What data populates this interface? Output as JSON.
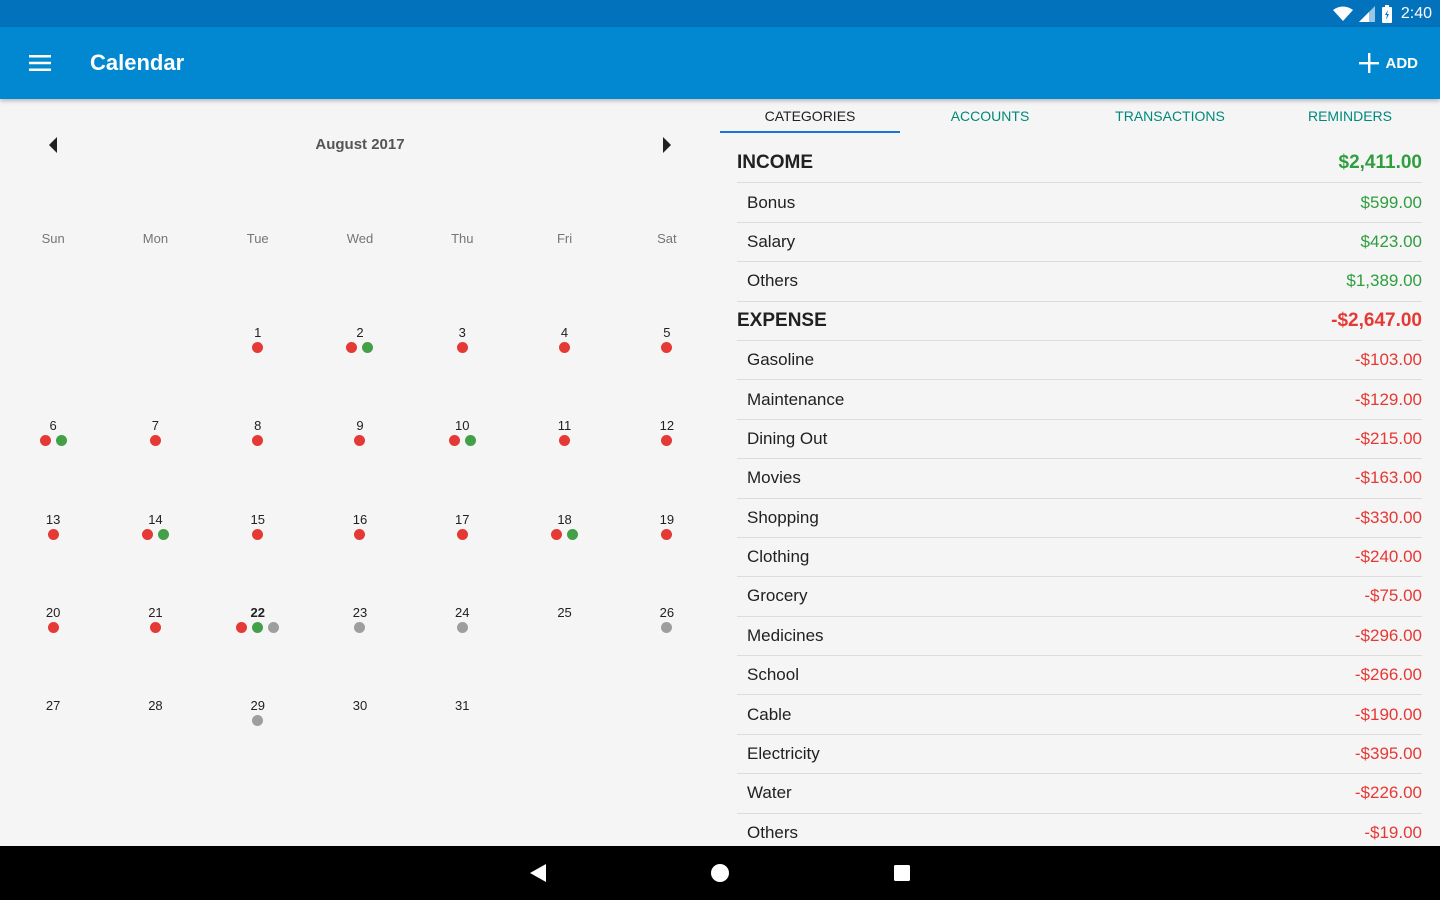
{
  "status_bar": {
    "time": "2:40"
  },
  "app_bar": {
    "title": "Calendar",
    "add_label": "ADD"
  },
  "calendar": {
    "month": "August 2017",
    "weekdays": [
      "Sun",
      "Mon",
      "Tue",
      "Wed",
      "Thu",
      "Fri",
      "Sat"
    ],
    "colors": {
      "income": "#43a047",
      "expense": "#e53935",
      "pending": "#9e9e9e"
    },
    "today": 22,
    "weeks": [
      [
        null,
        null,
        {
          "d": "1",
          "dots": [
            "expense"
          ]
        },
        {
          "d": "2",
          "dots": [
            "expense",
            "income"
          ]
        },
        {
          "d": "3",
          "dots": [
            "expense"
          ]
        },
        {
          "d": "4",
          "dots": [
            "expense"
          ]
        },
        {
          "d": "5",
          "dots": [
            "expense"
          ]
        }
      ],
      [
        {
          "d": "6",
          "dots": [
            "expense",
            "income"
          ]
        },
        {
          "d": "7",
          "dots": [
            "expense"
          ]
        },
        {
          "d": "8",
          "dots": [
            "expense"
          ]
        },
        {
          "d": "9",
          "dots": [
            "expense"
          ]
        },
        {
          "d": "10",
          "dots": [
            "expense",
            "income"
          ]
        },
        {
          "d": "11",
          "dots": [
            "expense"
          ]
        },
        {
          "d": "12",
          "dots": [
            "expense"
          ]
        }
      ],
      [
        {
          "d": "13",
          "dots": [
            "expense"
          ]
        },
        {
          "d": "14",
          "dots": [
            "expense",
            "income"
          ]
        },
        {
          "d": "15",
          "dots": [
            "expense"
          ]
        },
        {
          "d": "16",
          "dots": [
            "expense"
          ]
        },
        {
          "d": "17",
          "dots": [
            "expense"
          ]
        },
        {
          "d": "18",
          "dots": [
            "expense",
            "income"
          ]
        },
        {
          "d": "19",
          "dots": [
            "expense"
          ]
        }
      ],
      [
        {
          "d": "20",
          "dots": [
            "expense"
          ]
        },
        {
          "d": "21",
          "dots": [
            "expense"
          ]
        },
        {
          "d": "22",
          "dots": [
            "expense",
            "income",
            "pending"
          ]
        },
        {
          "d": "23",
          "dots": [
            "pending"
          ]
        },
        {
          "d": "24",
          "dots": [
            "pending"
          ]
        },
        {
          "d": "25",
          "dots": []
        },
        {
          "d": "26",
          "dots": [
            "pending"
          ]
        }
      ],
      [
        {
          "d": "27",
          "dots": []
        },
        {
          "d": "28",
          "dots": []
        },
        {
          "d": "29",
          "dots": [
            "pending"
          ]
        },
        {
          "d": "30",
          "dots": []
        },
        {
          "d": "31",
          "dots": []
        },
        null,
        null
      ]
    ]
  },
  "tabs": [
    {
      "label": "CATEGORIES",
      "active": true
    },
    {
      "label": "ACCOUNTS",
      "active": false
    },
    {
      "label": "TRANSACTIONS",
      "active": false
    },
    {
      "label": "REMINDERS",
      "active": false
    }
  ],
  "income": {
    "label": "INCOME",
    "total": "$2,411.00",
    "items": [
      {
        "name": "Bonus",
        "amount": "$599.00"
      },
      {
        "name": "Salary",
        "amount": "$423.00"
      },
      {
        "name": "Others",
        "amount": "$1,389.00"
      }
    ]
  },
  "expense": {
    "label": "EXPENSE",
    "total": "-$2,647.00",
    "items": [
      {
        "name": "Gasoline",
        "amount": "-$103.00"
      },
      {
        "name": "Maintenance",
        "amount": "-$129.00"
      },
      {
        "name": "Dining Out",
        "amount": "-$215.00"
      },
      {
        "name": "Movies",
        "amount": "-$163.00"
      },
      {
        "name": "Shopping",
        "amount": "-$330.00"
      },
      {
        "name": "Clothing",
        "amount": "-$240.00"
      },
      {
        "name": "Grocery",
        "amount": "-$75.00"
      },
      {
        "name": "Medicines",
        "amount": "-$296.00"
      },
      {
        "name": "School",
        "amount": "-$266.00"
      },
      {
        "name": "Cable",
        "amount": "-$190.00"
      },
      {
        "name": "Electricity",
        "amount": "-$395.00"
      },
      {
        "name": "Water",
        "amount": "-$226.00"
      },
      {
        "name": "Others",
        "amount": "-$19.00"
      }
    ]
  }
}
